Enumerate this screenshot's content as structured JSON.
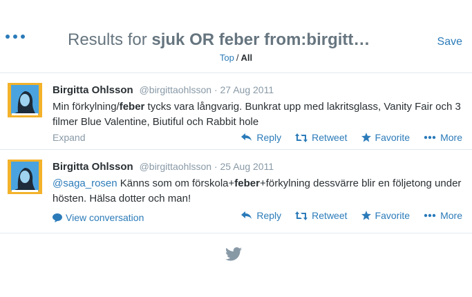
{
  "header": {
    "title_prefix": "Results for ",
    "title_query": "sjuk OR feber from:birgitt…",
    "save_label": "Save",
    "filter_top": "Top",
    "filter_sep": "/",
    "filter_all": "All"
  },
  "tweets": [
    {
      "name": "Birgitta Ohlsson",
      "handle": "@birgittaohlsson",
      "date": "· 27 Aug 2011",
      "text_before": "Min förkylning/",
      "text_bold": "feber",
      "text_after": " tycks vara långvarig. Bunkrat upp med lakritsglass, Vanity Fair och 3 filmer Blue Valentine, Biutiful och Rabbit hole",
      "footer_link": "Expand"
    },
    {
      "name": "Birgitta Ohlsson",
      "handle": "@birgittaohlsson",
      "date": "· 25 Aug 2011",
      "mention": "@saga_rosen",
      "text_before": " Känns som om förskola+",
      "text_bold": "feber",
      "text_after": "+förkylning dessvärre blir en följetong under hösten. Hälsa dotter och man!",
      "footer_link": "View conversation"
    }
  ],
  "actions": {
    "reply": "Reply",
    "retweet": "Retweet",
    "favorite": "Favorite",
    "more": "More"
  },
  "colors": {
    "link": "#2b7bb9",
    "muted": "#8899a6",
    "text": "#292f33",
    "avatar_bg": "#f3b22a",
    "avatar_frame": "#4aa3df"
  },
  "icons": [
    "more-dots-icon",
    "reply-icon",
    "retweet-icon",
    "favorite-star-icon",
    "more-dots-icon",
    "conversation-bubble-icon",
    "twitter-bird-icon"
  ]
}
